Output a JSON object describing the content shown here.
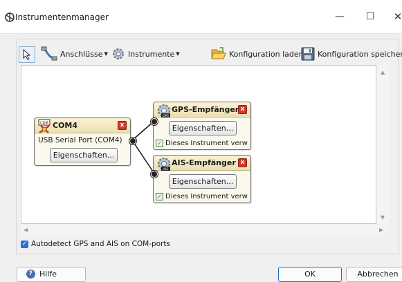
{
  "window": {
    "title": "Instrumentenmanager",
    "minimize_glyph": "—",
    "maximize_glyph": "☐",
    "close_glyph": "✕"
  },
  "toolbar": {
    "pointer_icon": "cursor-icon",
    "connections_label": "Anschlüsse",
    "instruments_label": "Instrumente",
    "load_label": "Konfiguration laden",
    "save_label": "Konfiguration speichern"
  },
  "canvas": {
    "port": {
      "title": "COM4",
      "description": "USB Serial Port (COM4)",
      "properties_label": "Eigenschaften..."
    },
    "gps": {
      "title": "GPS-Empfänger",
      "properties_label": "Eigenschaften...",
      "use_label": "Dieses Instrument verwend",
      "use_checked": true
    },
    "ais": {
      "title": "AIS-Empfänger",
      "properties_label": "Eigenschaften...",
      "use_label": "Dieses Instrument verwend",
      "use_checked": true
    }
  },
  "autodetect": {
    "label": "Autodetect GPS and AIS on COM-ports",
    "checked": true
  },
  "buttons": {
    "help": "Hilfe",
    "ok": "OK",
    "cancel": "Abbrechen"
  },
  "colors": {
    "accent": "#2f6fd3",
    "box_header": "#eadfb2",
    "close_red": "#d53a2c"
  }
}
